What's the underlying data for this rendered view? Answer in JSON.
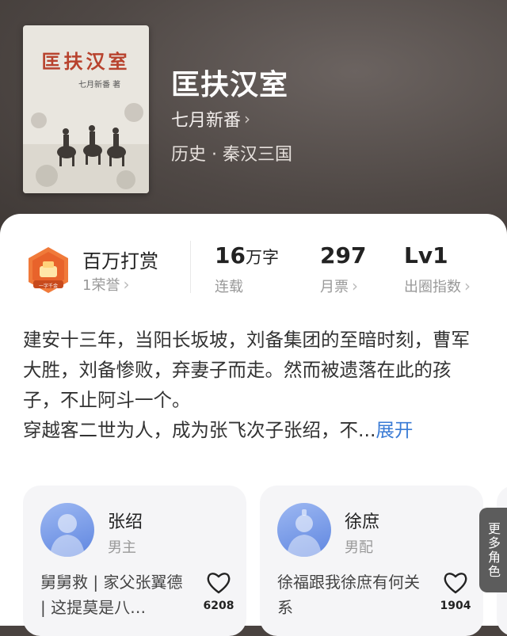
{
  "book": {
    "cover_title": "匡扶汉室",
    "cover_author": "七月新番 著",
    "title": "匡扶汉室",
    "author": "七月新番",
    "category": "历史 · 秦汉三国"
  },
  "stats": {
    "honor_title": "百万打赏",
    "honor_sub": "1荣誉",
    "badge_text": "一字千金",
    "words_num": "16",
    "words_unit": "万字",
    "status": "连载",
    "tickets": "297",
    "tickets_label": "月票",
    "level": "Lv1",
    "level_label": "出圈指数"
  },
  "description": {
    "text": "建安十三年，当阳长坂坡，刘备集团的至暗时刻，曹军大胜，刘备惨败，弃妻子而走。然而被遗落在此的孩子，不止阿斗一个。\n穿越客二世为人，成为张飞次子张绍，不...",
    "expand": "展开"
  },
  "characters": [
    {
      "name": "张绍",
      "role": "男主",
      "desc": "舅舅救 | 家父张翼德 | 这提莫是八…",
      "likes": "6208"
    },
    {
      "name": "徐庶",
      "role": "男配",
      "desc": "徐福跟我徐庶有何关系",
      "likes": "1904"
    }
  ],
  "more_roles": "更多角色",
  "colors": {
    "accent": "#3a7bd5",
    "hero_bg": "#4f4845",
    "badge": "#e8632b"
  }
}
